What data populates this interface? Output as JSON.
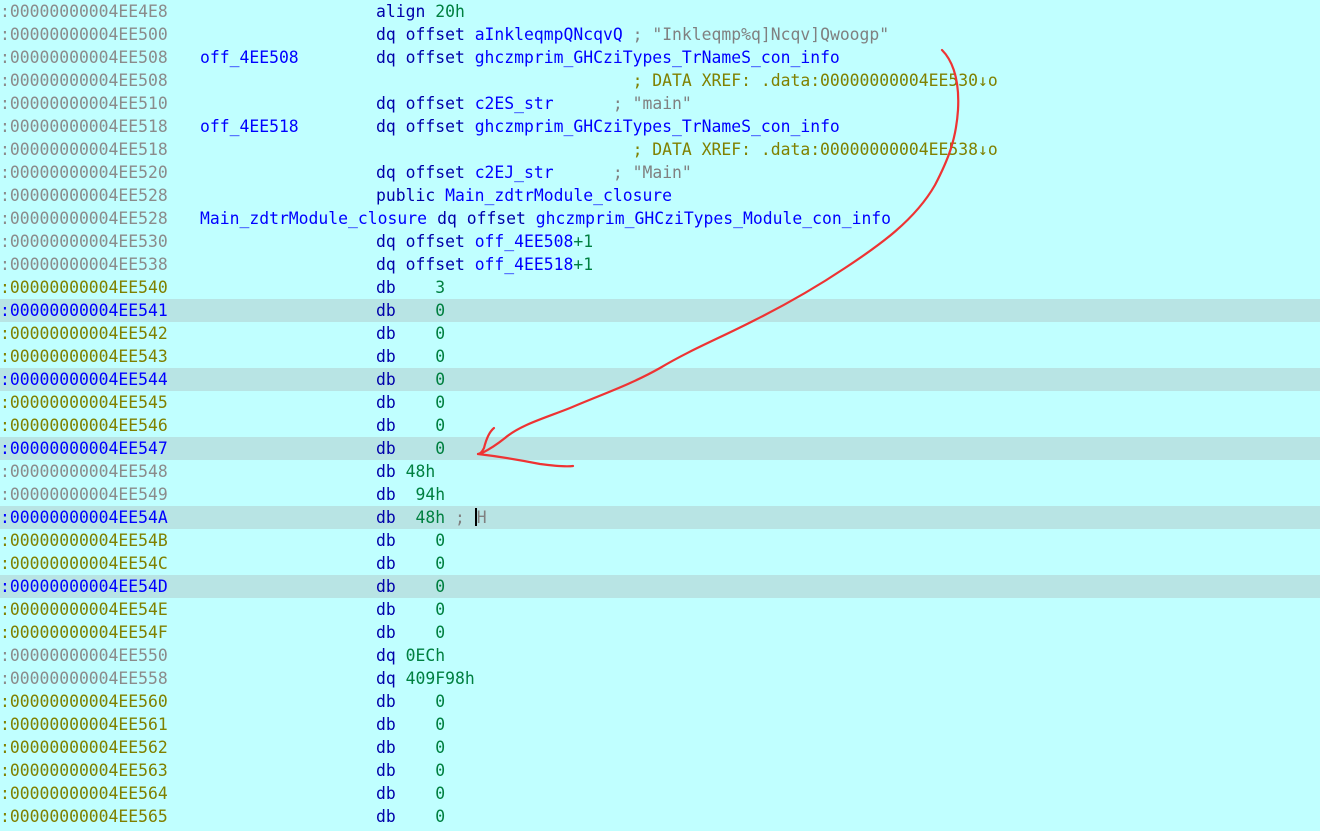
{
  "prefix": ":0000000000",
  "accent_arrow_color": "#ee3333",
  "lines": [
    {
      "addr": "4EE4E8",
      "addr_color": "grey",
      "label": "",
      "text": [
        [
          "kw",
          "align "
        ],
        [
          "num",
          "20h"
        ]
      ]
    },
    {
      "addr": "4EE500",
      "addr_color": "grey",
      "label": "",
      "text": [
        [
          "kw",
          "dq offset "
        ],
        [
          "name",
          "aInkleqmpQNcqvQ"
        ],
        [
          "cmt",
          " ; \"Inkleqmp%q]Ncqv]Qwoogp\""
        ]
      ]
    },
    {
      "addr": "4EE508",
      "addr_color": "grey",
      "label": "off_4EE508",
      "text": [
        [
          "kw",
          "dq offset "
        ],
        [
          "name",
          "ghczmprim_GHCziTypes_TrNameS_con_info"
        ]
      ]
    },
    {
      "addr": "4EE508",
      "addr_color": "grey",
      "label": "",
      "text": [
        [
          "xref",
          "                          ; DATA XREF: .data:00000000004EE530↓o"
        ]
      ]
    },
    {
      "addr": "4EE510",
      "addr_color": "grey",
      "label": "",
      "text": [
        [
          "kw",
          "dq offset "
        ],
        [
          "name",
          "c2ES_str"
        ],
        [
          "cmt",
          "      ; \"main\""
        ]
      ]
    },
    {
      "addr": "4EE518",
      "addr_color": "grey",
      "label": "off_4EE518",
      "text": [
        [
          "kw",
          "dq offset "
        ],
        [
          "name",
          "ghczmprim_GHCziTypes_TrNameS_con_info"
        ]
      ]
    },
    {
      "addr": "4EE518",
      "addr_color": "grey",
      "label": "",
      "text": [
        [
          "xref",
          "                          ; DATA XREF: .data:00000000004EE538↓o"
        ]
      ]
    },
    {
      "addr": "4EE520",
      "addr_color": "grey",
      "label": "",
      "text": [
        [
          "kw",
          "dq offset "
        ],
        [
          "name",
          "c2EJ_str"
        ],
        [
          "cmt",
          "      ; \"Main\""
        ]
      ]
    },
    {
      "addr": "4EE528",
      "addr_color": "grey",
      "label": "",
      "text": [
        [
          "kw",
          "public "
        ],
        [
          "name",
          "Main_zdtrModule_closure"
        ]
      ]
    },
    {
      "addr": "4EE528",
      "addr_color": "grey",
      "label": "Main_zdtrModule_closure",
      "label_inline": true,
      "text": [
        [
          "kw",
          " dq offset "
        ],
        [
          "name",
          "ghczmprim_GHCziTypes_Module_con_info"
        ]
      ]
    },
    {
      "addr": "4EE530",
      "addr_color": "grey",
      "label": "",
      "text": [
        [
          "kw",
          "dq offset "
        ],
        [
          "name",
          "off_4EE508"
        ],
        [
          "num",
          "+1"
        ]
      ]
    },
    {
      "addr": "4EE538",
      "addr_color": "grey",
      "label": "",
      "text": [
        [
          "kw",
          "dq offset "
        ],
        [
          "name",
          "off_4EE518"
        ],
        [
          "num",
          "+1"
        ]
      ]
    },
    {
      "addr": "4EE540",
      "addr_color": "olive",
      "label": "",
      "text": [
        [
          "kw",
          "db    "
        ],
        [
          "val",
          "3"
        ]
      ]
    },
    {
      "addr": "4EE541",
      "addr_color": "blue",
      "hl": true,
      "label": "",
      "text": [
        [
          "kw",
          "db    "
        ],
        [
          "val",
          "0"
        ]
      ]
    },
    {
      "addr": "4EE542",
      "addr_color": "olive",
      "label": "",
      "text": [
        [
          "kw",
          "db    "
        ],
        [
          "val",
          "0"
        ]
      ]
    },
    {
      "addr": "4EE543",
      "addr_color": "olive",
      "label": "",
      "text": [
        [
          "kw",
          "db    "
        ],
        [
          "val",
          "0"
        ]
      ]
    },
    {
      "addr": "4EE544",
      "addr_color": "blue",
      "hl": true,
      "label": "",
      "text": [
        [
          "kw",
          "db    "
        ],
        [
          "val",
          "0"
        ]
      ]
    },
    {
      "addr": "4EE545",
      "addr_color": "olive",
      "label": "",
      "text": [
        [
          "kw",
          "db    "
        ],
        [
          "val",
          "0"
        ]
      ]
    },
    {
      "addr": "4EE546",
      "addr_color": "olive",
      "label": "",
      "text": [
        [
          "kw",
          "db    "
        ],
        [
          "val",
          "0"
        ]
      ]
    },
    {
      "addr": "4EE547",
      "addr_color": "blue",
      "hl": true,
      "label": "",
      "text": [
        [
          "kw",
          "db    "
        ],
        [
          "val",
          "0"
        ]
      ]
    },
    {
      "addr": "4EE548",
      "addr_color": "grey",
      "label": "",
      "text": [
        [
          "kw",
          "db "
        ],
        [
          "val",
          "48h"
        ]
      ]
    },
    {
      "addr": "4EE549",
      "addr_color": "grey",
      "label": "",
      "text": [
        [
          "kw",
          "db  "
        ],
        [
          "val",
          "94h"
        ]
      ]
    },
    {
      "addr": "4EE54A",
      "addr_color": "blue",
      "hl": true,
      "cursor": true,
      "label": "",
      "text": [
        [
          "kw",
          "db  "
        ],
        [
          "val",
          "48h"
        ],
        [
          "cmt",
          " ; "
        ],
        [
          "cur",
          ""
        ],
        [
          "cmt",
          "H"
        ]
      ]
    },
    {
      "addr": "4EE54B",
      "addr_color": "olive",
      "label": "",
      "text": [
        [
          "kw",
          "db    "
        ],
        [
          "val",
          "0"
        ]
      ]
    },
    {
      "addr": "4EE54C",
      "addr_color": "olive",
      "label": "",
      "text": [
        [
          "kw",
          "db    "
        ],
        [
          "val",
          "0"
        ]
      ]
    },
    {
      "addr": "4EE54D",
      "addr_color": "blue",
      "hl": true,
      "label": "",
      "text": [
        [
          "kw",
          "db    "
        ],
        [
          "val",
          "0"
        ]
      ]
    },
    {
      "addr": "4EE54E",
      "addr_color": "olive",
      "label": "",
      "text": [
        [
          "kw",
          "db    "
        ],
        [
          "val",
          "0"
        ]
      ]
    },
    {
      "addr": "4EE54F",
      "addr_color": "olive",
      "label": "",
      "text": [
        [
          "kw",
          "db    "
        ],
        [
          "val",
          "0"
        ]
      ]
    },
    {
      "addr": "4EE550",
      "addr_color": "grey",
      "label": "",
      "text": [
        [
          "kw",
          "dq "
        ],
        [
          "val",
          "0ECh"
        ]
      ]
    },
    {
      "addr": "4EE558",
      "addr_color": "grey",
      "label": "",
      "text": [
        [
          "kw",
          "dq "
        ],
        [
          "val",
          "409F98h"
        ]
      ]
    },
    {
      "addr": "4EE560",
      "addr_color": "olive",
      "label": "",
      "text": [
        [
          "kw",
          "db    "
        ],
        [
          "val",
          "0"
        ]
      ]
    },
    {
      "addr": "4EE561",
      "addr_color": "olive",
      "label": "",
      "text": [
        [
          "kw",
          "db    "
        ],
        [
          "val",
          "0"
        ]
      ]
    },
    {
      "addr": "4EE562",
      "addr_color": "olive",
      "label": "",
      "text": [
        [
          "kw",
          "db    "
        ],
        [
          "val",
          "0"
        ]
      ]
    },
    {
      "addr": "4EE563",
      "addr_color": "olive",
      "label": "",
      "text": [
        [
          "kw",
          "db    "
        ],
        [
          "val",
          "0"
        ]
      ]
    },
    {
      "addr": "4EE564",
      "addr_color": "olive",
      "label": "",
      "text": [
        [
          "kw",
          "db    "
        ],
        [
          "val",
          "0"
        ]
      ]
    },
    {
      "addr": "4EE565",
      "addr_color": "olive",
      "label": "",
      "text": [
        [
          "kw",
          "db    "
        ],
        [
          "val",
          "0"
        ]
      ]
    }
  ]
}
